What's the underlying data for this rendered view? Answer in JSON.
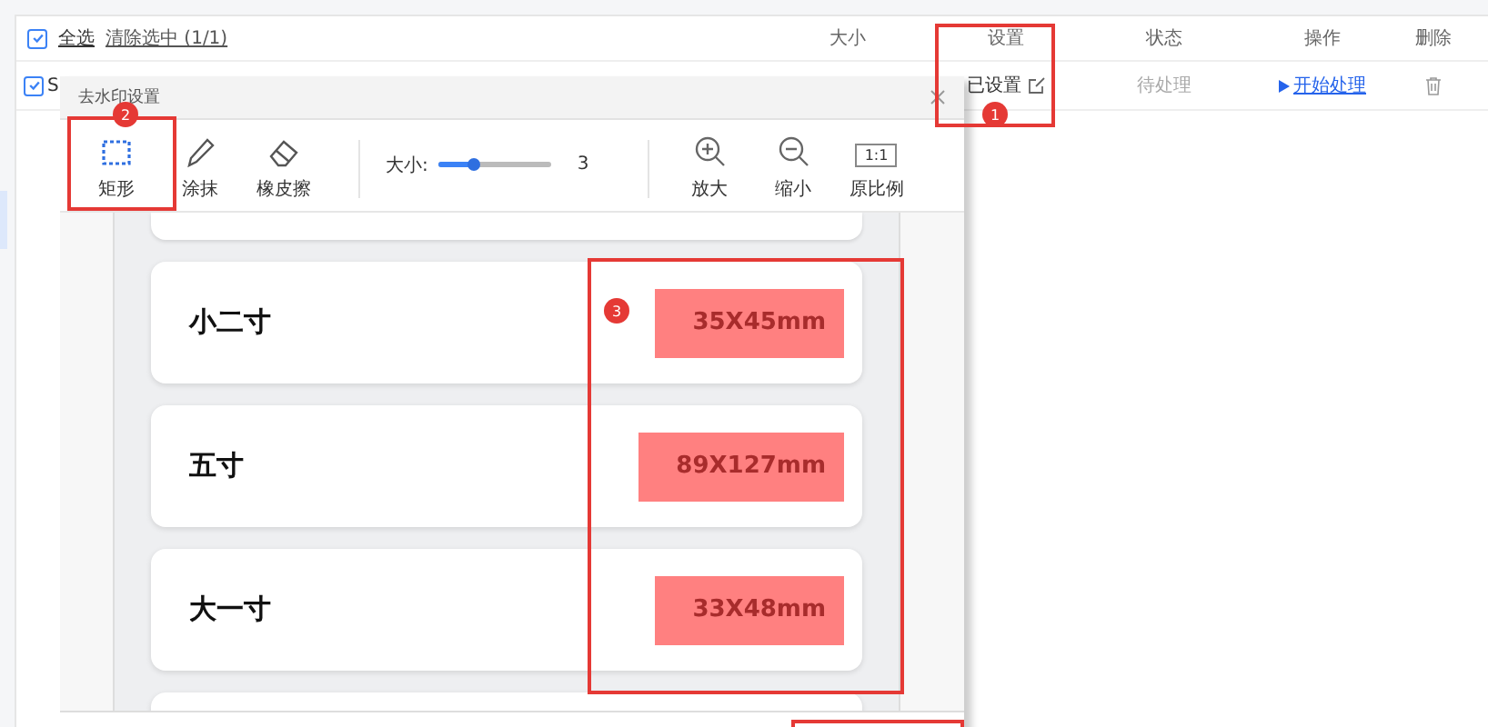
{
  "table": {
    "select_all": {
      "label": "全选",
      "checked": true
    },
    "clear_selection": "清除选中 (1/1)",
    "columns": [
      "大小",
      "设置",
      "状态",
      "操作",
      "删除"
    ],
    "rows": [
      {
        "checked": true,
        "name": "S",
        "setting": "已设置",
        "status": "待处理",
        "action": "开始处理"
      }
    ]
  },
  "dialog": {
    "title": "去水印设置",
    "tools": [
      {
        "kind": "rect",
        "label": "矩形",
        "selected": true
      },
      {
        "kind": "pen",
        "label": "涂抹",
        "selected": false
      },
      {
        "kind": "eraser",
        "label": "橡皮擦",
        "selected": false
      }
    ],
    "brush": {
      "label": "大小:",
      "level": 0.3,
      "value": "3"
    },
    "view_tools": [
      {
        "kind": "zoom-in",
        "label": "放大"
      },
      {
        "kind": "zoom-out",
        "label": "缩小"
      },
      {
        "kind": "ratio",
        "label": "原比例",
        "glyph": "1:1"
      }
    ],
    "sizes": [
      {
        "name": "小二寸",
        "dimension": "35X45mm"
      },
      {
        "name": "五寸",
        "dimension": "89X127mm"
      },
      {
        "name": "大一寸",
        "dimension": "33X48mm"
      }
    ]
  },
  "annotations": [
    {
      "kind": "numbered",
      "number": "1"
    },
    {
      "kind": "numbered",
      "number": "2"
    },
    {
      "kind": "numbered",
      "number": "3"
    },
    {
      "kind": "frame"
    }
  ]
}
